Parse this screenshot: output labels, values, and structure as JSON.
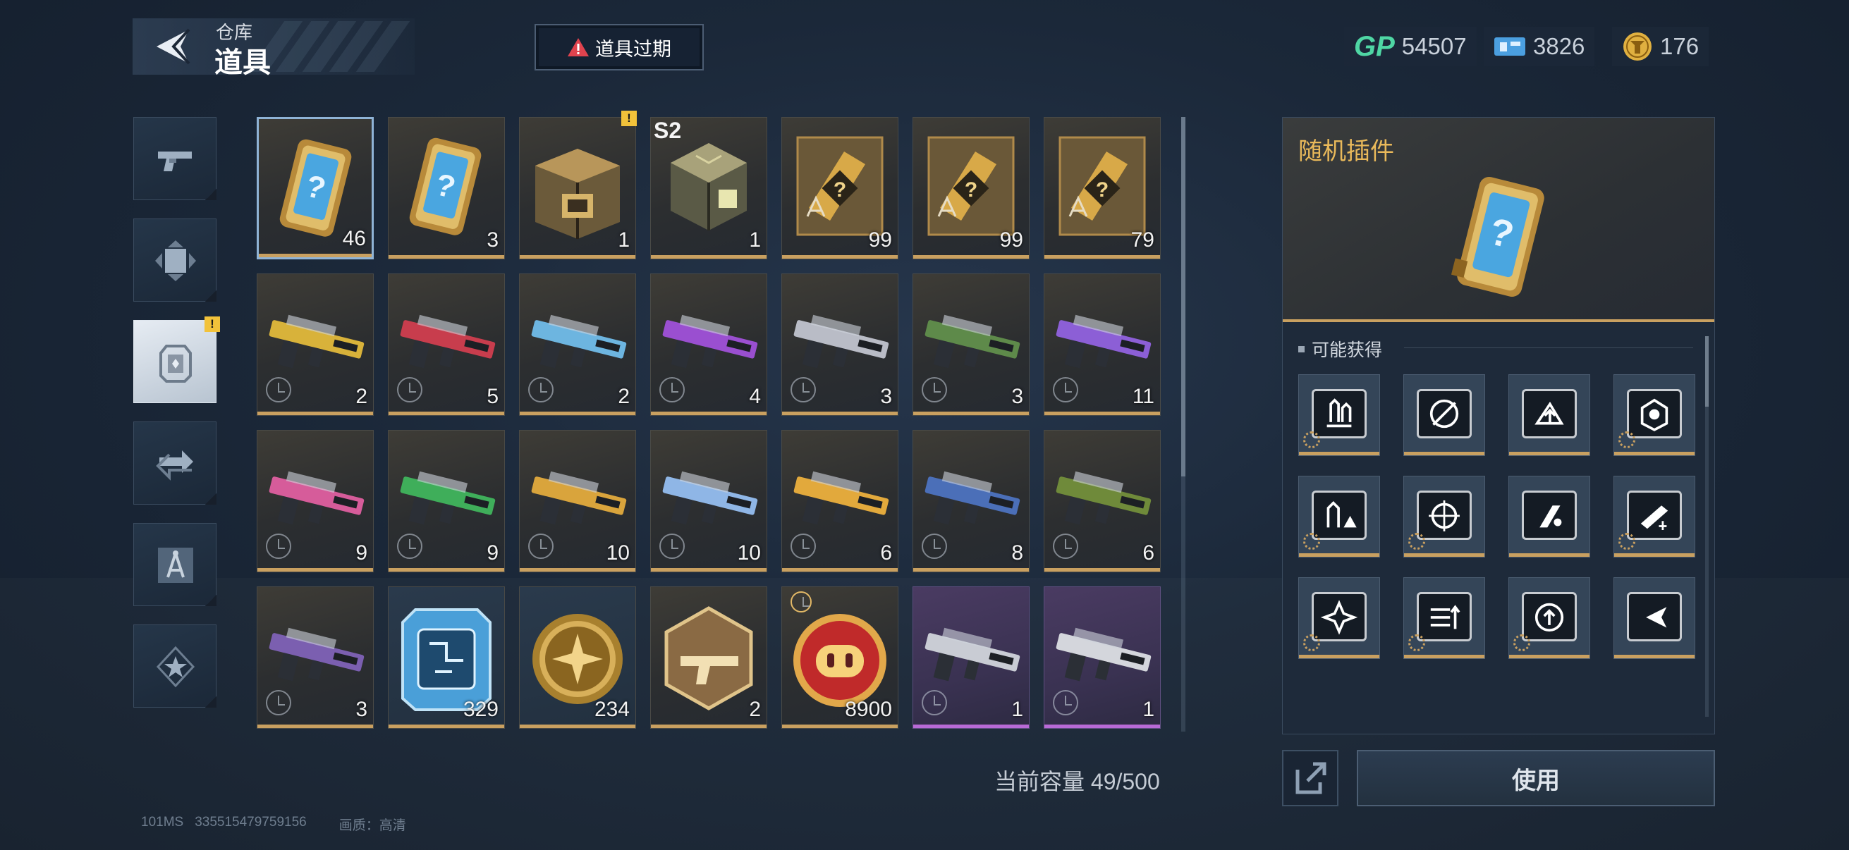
{
  "header": {
    "subtitle": "仓库",
    "title": "道具"
  },
  "expire_button": {
    "label": "道具过期"
  },
  "currencies": [
    {
      "icon": "gp-icon",
      "value": "54507"
    },
    {
      "icon": "ticket-icon",
      "value": "3826"
    },
    {
      "icon": "coin-icon",
      "value": "176"
    }
  ],
  "side_tabs": [
    {
      "icon": "pistol-icon",
      "active": false
    },
    {
      "icon": "card-icon",
      "active": false
    },
    {
      "icon": "plugin-icon",
      "active": true,
      "badge": "!"
    },
    {
      "icon": "exchange-icon",
      "active": false
    },
    {
      "icon": "compass-icon",
      "active": false
    },
    {
      "icon": "star-icon",
      "active": false
    }
  ],
  "items": [
    {
      "kind": "random-plugin",
      "count": "46",
      "selected": true
    },
    {
      "kind": "random-plugin",
      "count": "3"
    },
    {
      "kind": "supply-crate",
      "count": "1",
      "badge": "!"
    },
    {
      "kind": "season-cube",
      "count": "1",
      "season": "S2"
    },
    {
      "kind": "blueprint-box",
      "count": "99"
    },
    {
      "kind": "blueprint-box",
      "count": "99"
    },
    {
      "kind": "blueprint-box",
      "count": "79"
    },
    {
      "kind": "weapon-skin",
      "count": "2",
      "color": "#d8b23a",
      "timed": true
    },
    {
      "kind": "weapon-skin",
      "count": "5",
      "color": "#c83d4d",
      "timed": true
    },
    {
      "kind": "weapon-skin",
      "count": "2",
      "color": "#6db5e0",
      "timed": true
    },
    {
      "kind": "weapon-skin",
      "count": "4",
      "color": "#9a4fd0",
      "timed": true
    },
    {
      "kind": "weapon-skin",
      "count": "3",
      "color": "#b9bcc6",
      "timed": true
    },
    {
      "kind": "weapon-skin",
      "count": "3",
      "color": "#5e8a4a",
      "timed": true
    },
    {
      "kind": "weapon-skin",
      "count": "11",
      "color": "#8c5fd6",
      "timed": true
    },
    {
      "kind": "weapon-skin",
      "count": "9",
      "color": "#d65c9a",
      "timed": true
    },
    {
      "kind": "weapon-skin",
      "count": "9",
      "color": "#3fae5a",
      "timed": true
    },
    {
      "kind": "weapon-skin",
      "count": "10",
      "color": "#d9a43c",
      "timed": true
    },
    {
      "kind": "weapon-skin",
      "count": "10",
      "color": "#8fb6e6",
      "timed": true
    },
    {
      "kind": "weapon-skin",
      "count": "6",
      "color": "#e2a93c",
      "timed": true
    },
    {
      "kind": "weapon-skin",
      "count": "8",
      "color": "#4b6fb8",
      "timed": true
    },
    {
      "kind": "weapon-skin",
      "count": "6",
      "color": "#6f8a3a",
      "timed": true
    },
    {
      "kind": "weapon-skin",
      "count": "3",
      "color": "#7b5fb0",
      "timed": true
    },
    {
      "kind": "chip",
      "count": "329",
      "cell": "blue"
    },
    {
      "kind": "gold-coin",
      "count": "234",
      "cell": "blue"
    },
    {
      "kind": "gun-badge",
      "count": "2"
    },
    {
      "kind": "pig-coin",
      "count": "8900",
      "clock_top": true
    },
    {
      "kind": "weapon-skin",
      "count": "1",
      "color": "#c9ccd4",
      "timed": true,
      "cell": "purple"
    },
    {
      "kind": "weapon-skin",
      "count": "1",
      "color": "#d4d6dc",
      "timed": true,
      "cell": "purple"
    }
  ],
  "capacity": {
    "label": "当前容量 49/500"
  },
  "detail": {
    "title": "随机插件",
    "section_label": "可能获得",
    "plugins": [
      "bullets-plugin-icon",
      "no-scope-plugin-icon",
      "reload-up-plugin-icon",
      "armor-plugin-icon",
      "ammo-warning-plugin-icon",
      "crosshair-plugin-icon",
      "rocket-ammo-plugin-icon",
      "rifle-ammo-plugin-icon",
      "medkit-cross-plugin-icon",
      "fire-rate-plugin-icon",
      "shield-up-plugin-icon",
      "dash-plugin-icon"
    ],
    "gear_flags": [
      true,
      false,
      false,
      true,
      true,
      true,
      false,
      true,
      true,
      true,
      true,
      false
    ]
  },
  "use_button": {
    "label": "使用"
  },
  "footer": {
    "ping": "101MS",
    "uid": "335515479759156",
    "quality": "画质：高清"
  }
}
